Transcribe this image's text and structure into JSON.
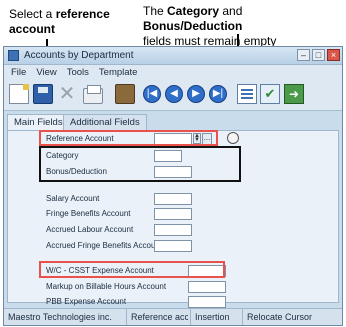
{
  "annotations": {
    "left": {
      "prefix": "Select a ",
      "bold": "reference account",
      "suffix": ""
    },
    "right": {
      "line1_prefix": "The ",
      "line1_bold1": "Category",
      "line1_mid": " and ",
      "line1_bold2": "Bonus/Deduction",
      "line2": "fields must remain empty"
    }
  },
  "window": {
    "title": "Accounts by Department",
    "buttons": {
      "minimize": "–",
      "maximize": "□",
      "close": "×"
    }
  },
  "menu": [
    "File",
    "View",
    "Tools",
    "Template"
  ],
  "toolbar": {
    "icons": [
      "new-icon",
      "save-icon",
      "delete-icon",
      "print-icon",
      "folder-icon",
      "first-record-icon",
      "previous-record-icon",
      "next-record-icon",
      "last-record-icon",
      "document-icon",
      "check-icon",
      "exit-icon"
    ],
    "nav_glyphs": {
      "first": "|◀",
      "prev": "◀",
      "next": "▶",
      "last": "▶|"
    }
  },
  "tabs": {
    "main": "Main Fields",
    "additional": "Additional Fields"
  },
  "form": {
    "reference_account": {
      "label": "Reference Account",
      "value": ""
    },
    "category": {
      "label": "Category",
      "value": ""
    },
    "bonus_deduction": {
      "label": "Bonus/Deduction",
      "value": ""
    },
    "salary_account": {
      "label": "Salary Account",
      "value": ""
    },
    "fringe_benefits_account": {
      "label": "Fringe Benefits Account",
      "value": ""
    },
    "accrued_labour_account": {
      "label": "Accrued Labour Account",
      "value": ""
    },
    "accrued_fringe_benefits_account": {
      "label": "Accrued Fringe Benefits Account",
      "value": ""
    },
    "wc_csst_expense_account": {
      "label": "W/C - CSST Expense Account",
      "value": ""
    },
    "markup_billable_hours_account": {
      "label": "Markup on Billable Hours Account",
      "value": ""
    },
    "pbb_expense_account": {
      "label": "PBB Expense Account",
      "value": ""
    },
    "ellipsis": "..."
  },
  "status": {
    "company": "Maestro Technologies inc.",
    "context": "Reference acc...",
    "mode": "Insertion",
    "action": "Relocate Cursor"
  },
  "colors": {
    "highlight_red": "#e8524a",
    "highlight_black": "#111111",
    "window_bg": "#c9dcec"
  }
}
